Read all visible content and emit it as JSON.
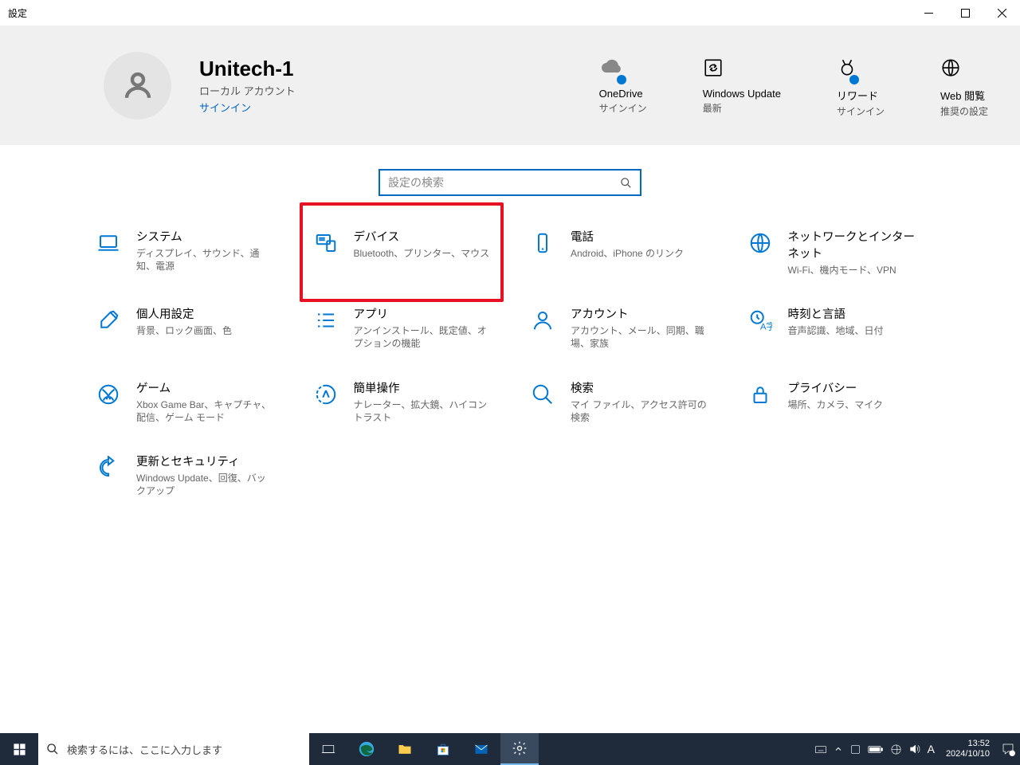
{
  "window": {
    "title": "設定"
  },
  "user": {
    "name": "Unitech-1",
    "type": "ローカル アカウント",
    "signin": "サインイン"
  },
  "status": [
    {
      "label": "OneDrive",
      "sub": "サインイン"
    },
    {
      "label": "Windows Update",
      "sub": "最新"
    },
    {
      "label": "リワード",
      "sub": "サインイン"
    },
    {
      "label": "Web 閲覧",
      "sub": "推奨の設定"
    }
  ],
  "search": {
    "placeholder": "設定の検索"
  },
  "cards": [
    {
      "title": "システム",
      "sub": "ディスプレイ、サウンド、通知、電源"
    },
    {
      "title": "デバイス",
      "sub": "Bluetooth、プリンター、マウス"
    },
    {
      "title": "電話",
      "sub": "Android、iPhone のリンク"
    },
    {
      "title": "ネットワークとインターネット",
      "sub": "Wi-Fi、機内モード、VPN"
    },
    {
      "title": "個人用設定",
      "sub": "背景、ロック画面、色"
    },
    {
      "title": "アプリ",
      "sub": "アンインストール、既定値、オプションの機能"
    },
    {
      "title": "アカウント",
      "sub": "アカウント、メール、同期、職場、家族"
    },
    {
      "title": "時刻と言語",
      "sub": "音声認識、地域、日付"
    },
    {
      "title": "ゲーム",
      "sub": "Xbox Game Bar、キャプチャ、配信、ゲーム モード"
    },
    {
      "title": "簡単操作",
      "sub": "ナレーター、拡大鏡、ハイコントラスト"
    },
    {
      "title": "検索",
      "sub": "マイ ファイル、アクセス許可の検索"
    },
    {
      "title": "プライバシー",
      "sub": "場所、カメラ、マイク"
    },
    {
      "title": "更新とセキュリティ",
      "sub": "Windows Update、回復、バックアップ"
    }
  ],
  "taskbar": {
    "search_placeholder": "検索するには、ここに入力します",
    "clock_time": "13:52",
    "clock_date": "2024/10/10",
    "ime": "A"
  }
}
